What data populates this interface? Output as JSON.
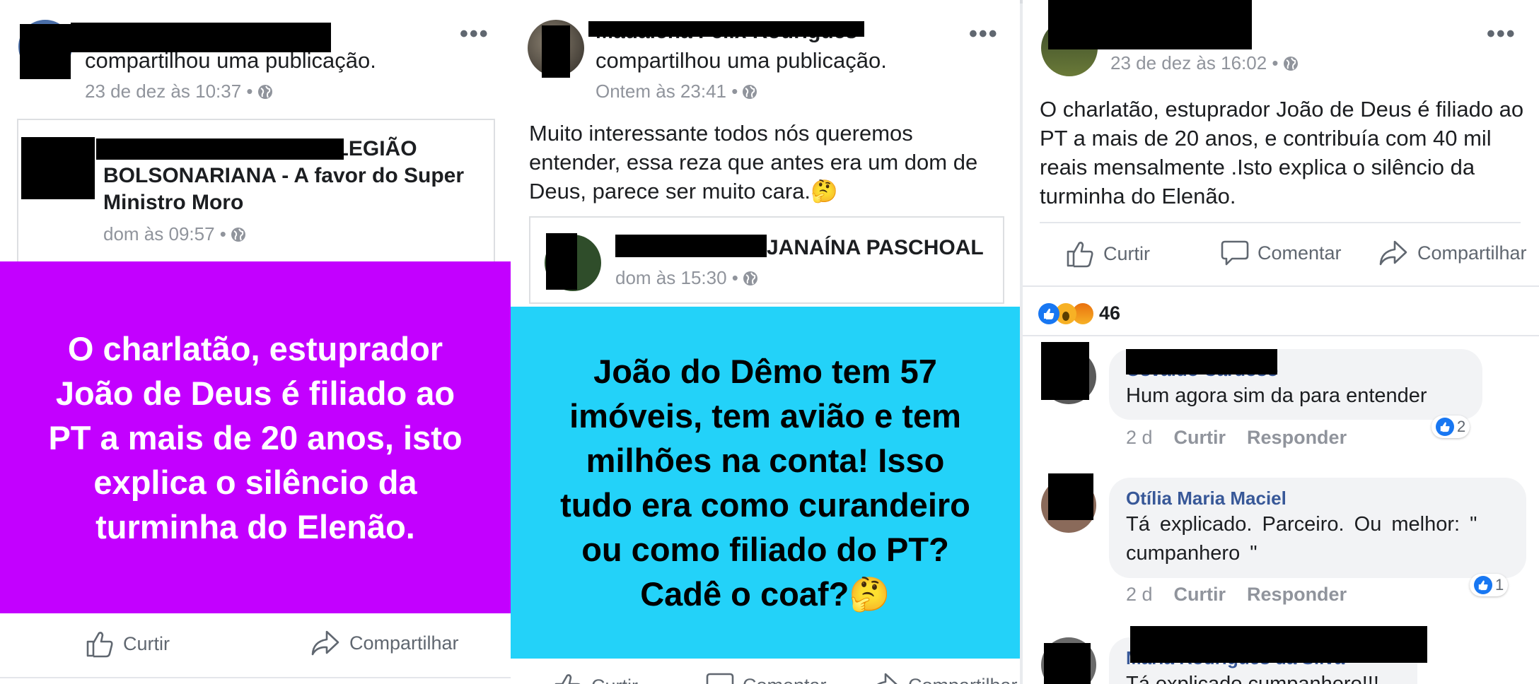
{
  "post1": {
    "shared_text": "compartilhou uma publicação.",
    "timestamp": "23 de dez às 10:37 •",
    "card_title": "Vanderlei Guimarães ▸ LEGIÃO BOLSONARIANA - A favor do Super Ministro Moro",
    "card_timestamp": "dom às 09:57 •",
    "image_text": "O charlatão, estuprador João de Deus é filiado ao PT a mais de 20 anos, isto explica o silêncio da turminha do Elenão.",
    "image_bg": "#c300ff",
    "actions": {
      "like": "Curtir",
      "share": "Compartilhar"
    }
  },
  "post2": {
    "author": "Madalena Felix Rodrigues",
    "shared_text": "compartilhou uma publicação.",
    "timestamp": "Ontem às 23:41 •",
    "body": "Muito interessante todos nós queremos entender, essa reza que antes era um dom de Deus, parece ser muito cara.🤔",
    "card_title": "JANAÍNA PASCHOAL",
    "card_timestamp": "dom às 15:30 •",
    "image_text": "João do Dêmo tem 57 imóveis, tem avião e tem milhões na conta! Isso tudo era como curandeiro ou como filiado do PT? Cadê o coaf?🤔",
    "image_bg": "#23d2f9",
    "actions": {
      "like": "Curtir",
      "comment": "Comentar",
      "share": "Compartilhar"
    }
  },
  "post3": {
    "timestamp": "23 de dez às 16:02 •",
    "body": "O charlatão, estuprador João de Deus é filiado ao PT a mais de 20 anos, e contribuía com 40 mil reais mensalmente .Isto explica o silêncio da turminha do Elenão.",
    "actions": {
      "like": "Curtir",
      "comment": "Comentar",
      "share": "Compartilhar"
    },
    "reaction_count": "46",
    "comments": [
      {
        "name": "Osvaldo Cardoso",
        "text": "Hum agora sim da para entender",
        "age": "2 d",
        "like": "Curtir",
        "reply": "Responder",
        "reactions": "2"
      },
      {
        "name": "Otília Maria Maciel",
        "text": "Tá explicado. Parceiro. Ou melhor: \" cumpanhero \"",
        "age": "2 d",
        "like": "Curtir",
        "reply": "Responder",
        "reactions": "1"
      },
      {
        "name": "Maria Rodrigues da Silva",
        "text": "Tá explicado cumpanhero!!!"
      }
    ]
  },
  "colors": {
    "link": "#385898",
    "meta": "#90949c",
    "like_blue": "#1877f2",
    "censor": "#000000"
  }
}
